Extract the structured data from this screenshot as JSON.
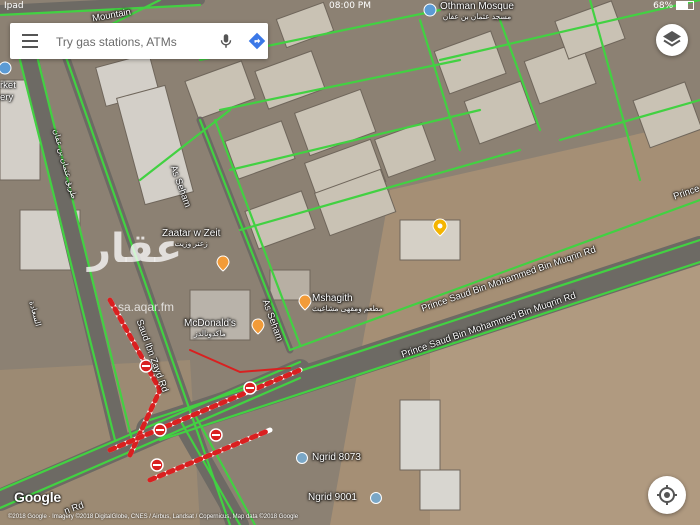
{
  "status_bar": {
    "carrier": "Ipad",
    "time": "08:00 PM",
    "battery": "68%"
  },
  "search": {
    "placeholder": "Try gas stations, ATMs"
  },
  "attribution": {
    "logo": "Google",
    "copyright": "©2018 Google · Imagery ©2018 DigitalGlobe, CNES / Airbus, Landsat / Copernicus, Map data ©2018 Google"
  },
  "places": [
    {
      "name": "Othman Mosque",
      "arabic": "مسجد عثمان بن عفان"
    },
    {
      "name": "Zaatar w Zeit",
      "arabic": "زعتر وزيت"
    },
    {
      "name": "McDonald's",
      "arabic": "ماكدونالدز"
    },
    {
      "name": "Mshagith",
      "arabic": "مطعم ومقهى مشاغيث"
    },
    {
      "name": "Ngrid 8073"
    },
    {
      "name": "Ngrid 9001"
    }
  ],
  "roads": {
    "top_left": "Mountain",
    "as_seham_1": "As Seham",
    "as_seham_2": "As Seham",
    "prince_saud_1": "Prince Saud Bin Mohammed Bin Muqrin Rd",
    "prince_saud_2": "Prince Saud Bin Mohammed Bin Muqrin Rd",
    "prince_saud_3": "Prince Saud Bin Mohammed Bin Muqrin Rd",
    "saud_bin_zayd": "Saud Ibn Zayd Rd",
    "bottom_left": "n Rd",
    "left_ar": "طريق عثمان بن عفان",
    "left_ar_2": "السعادة"
  },
  "left_edge_labels": [
    "rket",
    "ery"
  ],
  "watermark": {
    "text": "عقار",
    "url": "sa.aqar.fm"
  },
  "colors": {
    "traffic": "#42d142",
    "closure": "#d92020",
    "map_bg": "#8a7f70",
    "selected_pin": "#f4b400",
    "poi_food": "#f29b38"
  }
}
